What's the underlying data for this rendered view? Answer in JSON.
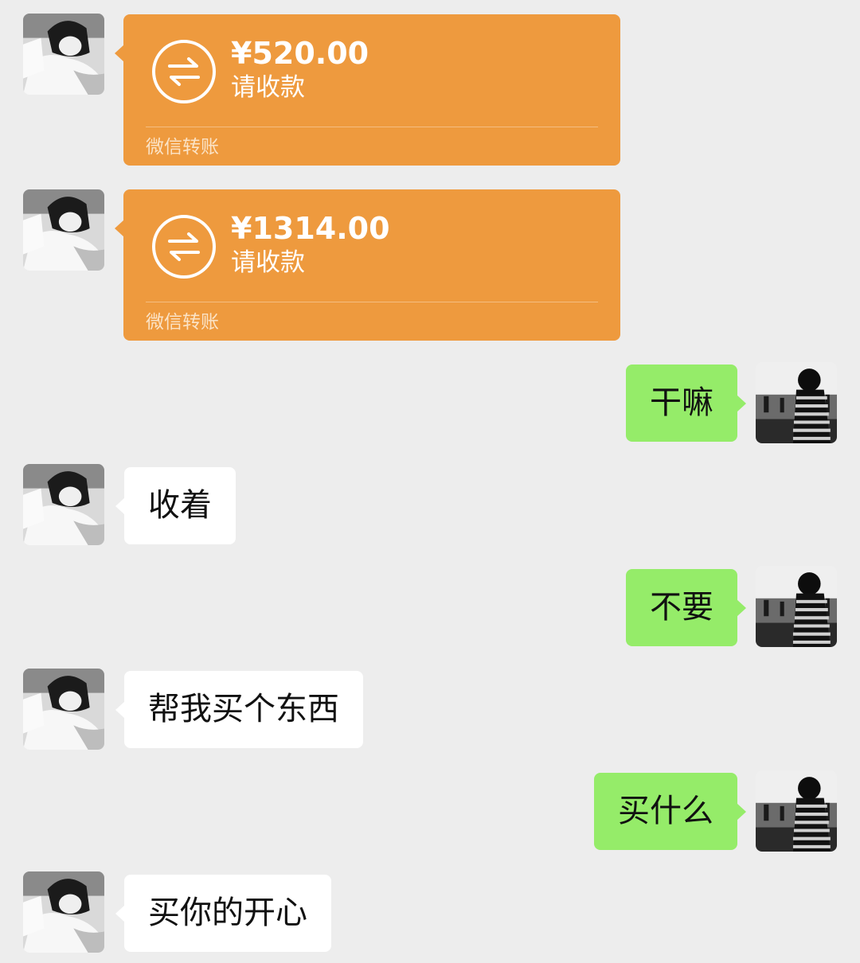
{
  "messages": {
    "transfer_1": {
      "amount": "¥520.00",
      "status": "请收款",
      "footer": "微信转账"
    },
    "transfer_2": {
      "amount": "¥1314.00",
      "status": "请收款",
      "footer": "微信转账"
    },
    "msg_3": {
      "sender": "self",
      "text": "干嘛"
    },
    "msg_4": {
      "sender": "contact",
      "text": "收着"
    },
    "msg_5": {
      "sender": "self",
      "text": "不要"
    },
    "msg_6": {
      "sender": "contact",
      "text": "帮我买个东西"
    },
    "msg_7": {
      "sender": "self",
      "text": "买什么"
    },
    "msg_8": {
      "sender": "contact",
      "text": "买你的开心"
    }
  },
  "colors": {
    "background": "#ededed",
    "self_bubble": "#95ec69",
    "contact_bubble": "#ffffff",
    "transfer_card": "#ee9a3e"
  },
  "icons": {
    "transfer": "transfer-arrows-icon",
    "contact_avatar": "contact-avatar",
    "self_avatar": "self-avatar"
  }
}
